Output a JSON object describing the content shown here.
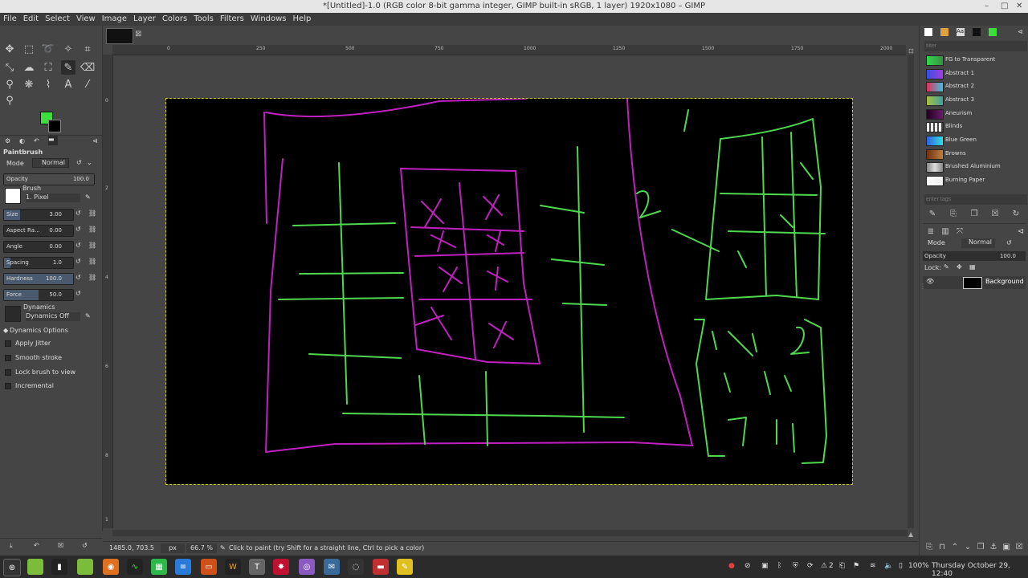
{
  "window": {
    "title": "*[Untitled]-1.0 (RGB color 8-bit gamma integer, GIMP built-in sRGB, 1 layer) 1920x1080 – GIMP",
    "controls": [
      "–",
      "□",
      "✕"
    ]
  },
  "menu": [
    "File",
    "Edit",
    "Select",
    "View",
    "Image",
    "Layer",
    "Colors",
    "Tools",
    "Filters",
    "Windows",
    "Help"
  ],
  "tool_options": {
    "title": "Paintbrush",
    "mode_label": "Mode",
    "mode_value": "Normal",
    "opacity_label": "Opacity",
    "opacity_value": "100.0",
    "brush_label": "Brush",
    "brush_value": "1. Pixel",
    "params": [
      {
        "label": "Size",
        "value": "3.00"
      },
      {
        "label": "Aspect Ra...",
        "value": "0.00"
      },
      {
        "label": "Angle",
        "value": "0.00"
      },
      {
        "label": "Spacing",
        "value": "1.0"
      },
      {
        "label": "Hardness",
        "value": "100.0"
      },
      {
        "label": "Force",
        "value": "50.0"
      }
    ],
    "dynamics_label": "Dynamics",
    "dynamics_value": "Dynamics Off",
    "dynamics_options": "Dynamics Options",
    "checks": [
      "Apply Jitter",
      "Smooth stroke",
      "Lock brush to view",
      "Incremental"
    ]
  },
  "rulers": {
    "top": [
      "0",
      "250",
      "500",
      "750",
      "1000",
      "1250",
      "1500",
      "1750",
      "2000"
    ],
    "left": [
      "0",
      "2",
      "4",
      "6",
      "8",
      "1"
    ]
  },
  "status": {
    "coords": "1485.0, 703.5",
    "unit": "px",
    "zoom": "66.7 %",
    "message": "Click to paint (try Shift for a straight line, Ctrl to pick a color)"
  },
  "gradients": {
    "filter_placeholder": "filter",
    "tags_placeholder": "enter tags",
    "items": [
      {
        "name": "FG to Transparent",
        "color": "#2fd84a"
      },
      {
        "name": "Abstract 1",
        "color": "#3a4de0"
      },
      {
        "name": "Abstract 2",
        "color": "#e0305a"
      },
      {
        "name": "Abstract 3",
        "color": "#a8c040"
      },
      {
        "name": "Aneurism",
        "color": "#6a1a6a"
      },
      {
        "name": "Blinds",
        "color": "#d0d0d0"
      },
      {
        "name": "Blue Green",
        "color": "#30d0e0"
      },
      {
        "name": "Browns",
        "color": "#a06030"
      },
      {
        "name": "Brushed Aluminium",
        "color": "#b0b0b0"
      },
      {
        "name": "Burning Paper",
        "color": "#f0f0f0"
      }
    ]
  },
  "layers": {
    "mode_label": "Mode",
    "mode_value": "Normal",
    "opacity_label": "Opacity",
    "opacity_value": "100.0",
    "lock_label": "Lock:",
    "layer_name": "Background"
  },
  "taskbar": {
    "battery": "100%",
    "clock": "Thursday October 29, 12:40",
    "badge": "2"
  },
  "colors": {
    "fg": "#3ce03c",
    "bg": "#000000",
    "stroke_green": "#4ed84e",
    "stroke_magenta": "#c020c0"
  }
}
